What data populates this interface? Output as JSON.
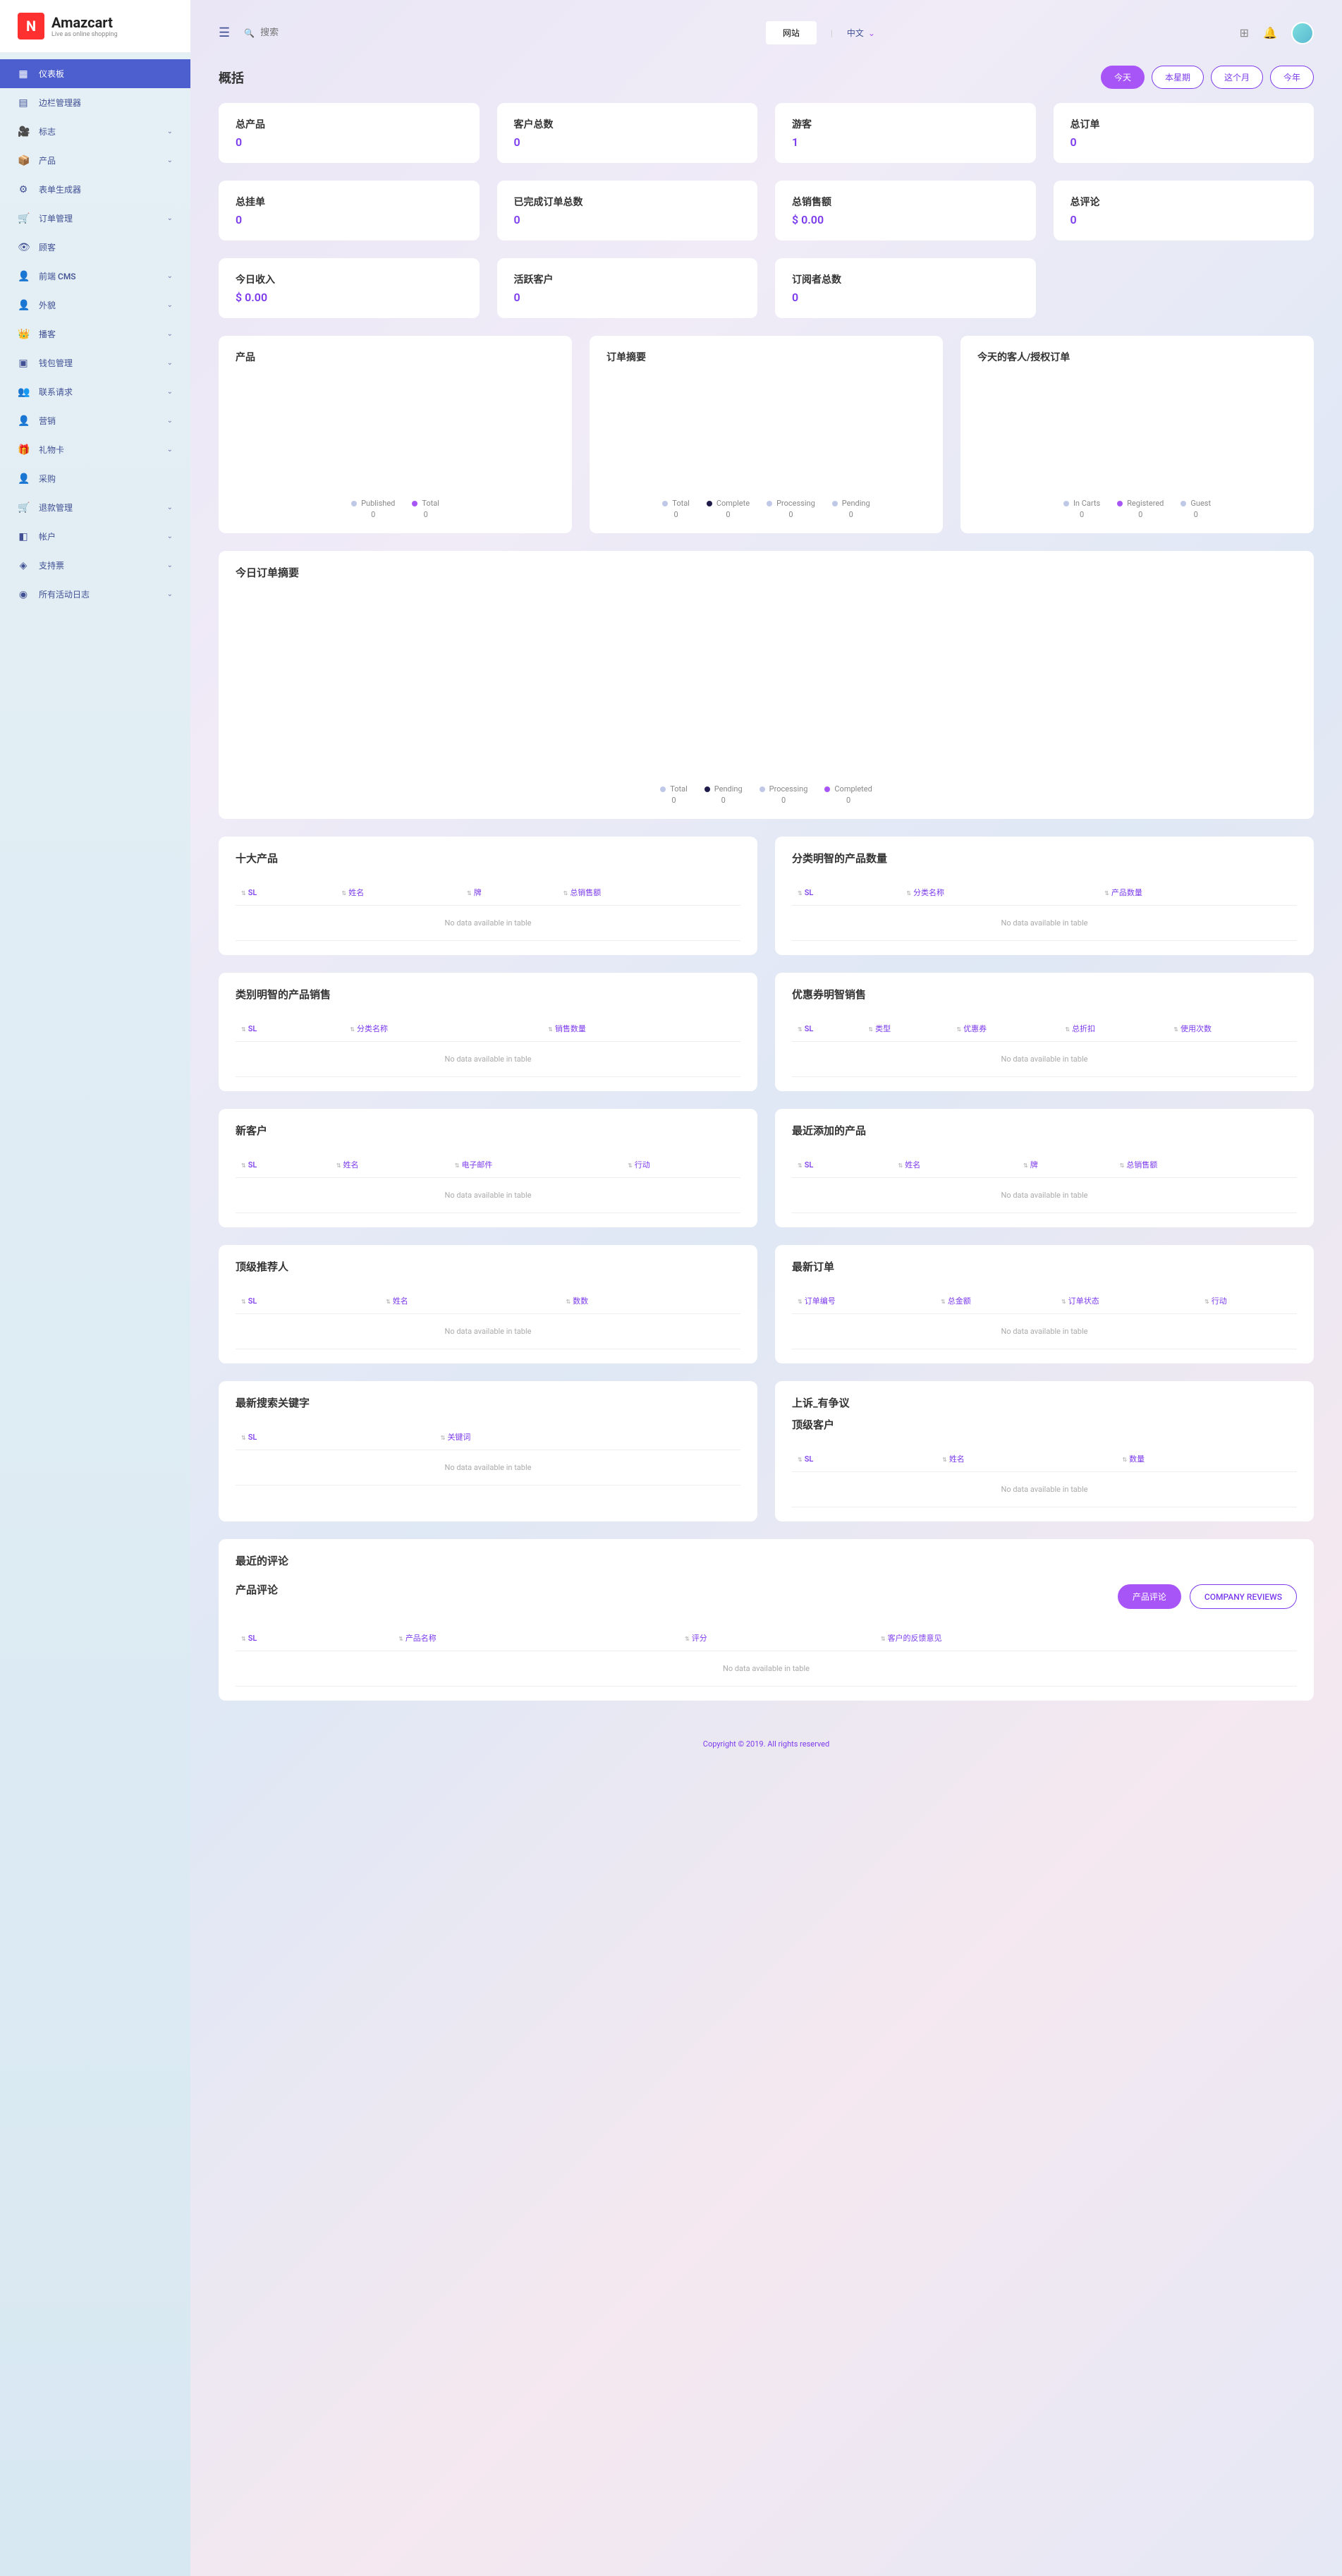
{
  "logo": {
    "name": "Amazcart",
    "tagline": "Live as online shopping"
  },
  "nav": [
    {
      "icon": "▦",
      "label": "仪表板",
      "active": true,
      "sub": false
    },
    {
      "icon": "▤",
      "label": "边栏管理器",
      "active": false,
      "sub": false
    },
    {
      "icon": "🎥",
      "label": "标志",
      "active": false,
      "sub": true
    },
    {
      "icon": "📦",
      "label": "产品",
      "active": false,
      "sub": true
    },
    {
      "icon": "⚙",
      "label": "表单生成器",
      "active": false,
      "sub": false
    },
    {
      "icon": "🛒",
      "label": "订单管理",
      "active": false,
      "sub": true
    },
    {
      "icon": "👁",
      "label": "顾客",
      "active": false,
      "sub": false
    },
    {
      "icon": "👤",
      "label": "前端 CMS",
      "active": false,
      "sub": true
    },
    {
      "icon": "👤",
      "label": "外貌",
      "active": false,
      "sub": true
    },
    {
      "icon": "👑",
      "label": "播客",
      "active": false,
      "sub": true
    },
    {
      "icon": "▣",
      "label": "钱包管理",
      "active": false,
      "sub": true
    },
    {
      "icon": "👥",
      "label": "联系请求",
      "active": false,
      "sub": true
    },
    {
      "icon": "👤",
      "label": "营销",
      "active": false,
      "sub": true
    },
    {
      "icon": "🎁",
      "label": "礼物卡",
      "active": false,
      "sub": true
    },
    {
      "icon": "👤",
      "label": "采购",
      "active": false,
      "sub": false
    },
    {
      "icon": "🛒",
      "label": "退款管理",
      "active": false,
      "sub": true
    },
    {
      "icon": "◧",
      "label": "帐户",
      "active": false,
      "sub": true
    },
    {
      "icon": "◈",
      "label": "支持票",
      "active": false,
      "sub": true
    },
    {
      "icon": "◉",
      "label": "所有活动日志",
      "active": false,
      "sub": true
    }
  ],
  "topbar": {
    "search_ph": "搜索",
    "website": "网站",
    "lang": "中文"
  },
  "overview": {
    "title": "概括"
  },
  "filters": [
    {
      "label": "今天",
      "active": true
    },
    {
      "label": "本星期",
      "active": false
    },
    {
      "label": "这个月",
      "active": false
    },
    {
      "label": "今年",
      "active": false
    }
  ],
  "stats": [
    {
      "label": "总产品",
      "value": "0"
    },
    {
      "label": "客户总数",
      "value": "0"
    },
    {
      "label": "游客",
      "value": "1"
    },
    {
      "label": "总订单",
      "value": "0"
    },
    {
      "label": "总挂单",
      "value": "0"
    },
    {
      "label": "已完成订单总数",
      "value": "0"
    },
    {
      "label": "总销售额",
      "value": "$ 0.00"
    },
    {
      "label": "总评论",
      "value": "0"
    },
    {
      "label": "今日收入",
      "value": "$ 0.00"
    },
    {
      "label": "活跃客户",
      "value": "0"
    },
    {
      "label": "订阅者总数",
      "value": "0"
    }
  ],
  "charts": {
    "c1": {
      "title": "产品",
      "legend": [
        {
          "label": "Published",
          "v": "0",
          "c": "#c0c8e8"
        },
        {
          "label": "Total",
          "v": "0",
          "c": "#a855f7"
        }
      ]
    },
    "c2": {
      "title": "订单摘要",
      "legend": [
        {
          "label": "Total",
          "v": "0",
          "c": "#c0c8e8"
        },
        {
          "label": "Complete",
          "v": "0",
          "c": "#1e1b4b"
        },
        {
          "label": "Processing",
          "v": "0",
          "c": "#c0c8e8"
        },
        {
          "label": "Pending",
          "v": "0",
          "c": "#c0c8e8"
        }
      ]
    },
    "c3": {
      "title": "今天的客人/授权订单",
      "legend": [
        {
          "label": "In Carts",
          "v": "0",
          "c": "#c0c8e8"
        },
        {
          "label": "Registered",
          "v": "0",
          "c": "#a855f7"
        },
        {
          "label": "Guest",
          "v": "0",
          "c": "#c0c8e8"
        }
      ]
    },
    "wide": {
      "title": "今日订单摘要",
      "legend": [
        {
          "label": "Total",
          "v": "0",
          "c": "#c0c8e8"
        },
        {
          "label": "Pending",
          "v": "0",
          "c": "#1e1b4b"
        },
        {
          "label": "Processing",
          "v": "0",
          "c": "#c0c8e8"
        },
        {
          "label": "Completed",
          "v": "0",
          "c": "#a855f7"
        }
      ]
    }
  },
  "tables": {
    "top_products": {
      "title": "十大产品",
      "cols": [
        "SL",
        "姓名",
        "牌",
        "总销售额"
      ]
    },
    "cat_products": {
      "title": "分类明智的产品数量",
      "cols": [
        "SL",
        "分类名称",
        "产品数量"
      ]
    },
    "cat_sales": {
      "title": "类别明智的产品销售",
      "cols": [
        "SL",
        "分类名称",
        "销售数量"
      ]
    },
    "coupon_sales": {
      "title": "优惠券明智销售",
      "cols": [
        "SL",
        "类型",
        "优惠券",
        "总折扣",
        "使用次数"
      ]
    },
    "new_customers": {
      "title": "新客户",
      "cols": [
        "SL",
        "姓名",
        "电子邮件",
        "行动"
      ]
    },
    "recent_products": {
      "title": "最近添加的产品",
      "cols": [
        "SL",
        "姓名",
        "牌",
        "总销售额"
      ]
    },
    "top_referrers": {
      "title": "顶级推荐人",
      "cols": [
        "SL",
        "姓名",
        "数数"
      ]
    },
    "latest_orders": {
      "title": "最新订单",
      "cols": [
        "订单编号",
        "总金额",
        "订单状态",
        "行动"
      ]
    },
    "latest_search": {
      "title": "最新搜索关键字",
      "cols": [
        "SL",
        "关键词"
      ]
    },
    "appeals": {
      "title": "上诉_有争议"
    },
    "top_customers": {
      "title": "顶级客户",
      "cols": [
        "SL",
        "姓名",
        "数量"
      ]
    },
    "recent_reviews": {
      "title": "最近的评论",
      "subtitle": "产品评论",
      "tabs": [
        "产品评论",
        "COMPANY REVIEWS"
      ],
      "cols": [
        "SL",
        "产品名称",
        "评分",
        "客户的反馈意见"
      ]
    }
  },
  "no_data": "No data available in table",
  "footer": {
    "text": "Copyright © 2019. All rights reserved"
  },
  "chart_data": [
    {
      "type": "pie",
      "title": "产品",
      "series": [
        {
          "name": "Published",
          "value": 0
        },
        {
          "name": "Total",
          "value": 0
        }
      ]
    },
    {
      "type": "pie",
      "title": "订单摘要",
      "series": [
        {
          "name": "Total",
          "value": 0
        },
        {
          "name": "Complete",
          "value": 0
        },
        {
          "name": "Processing",
          "value": 0
        },
        {
          "name": "Pending",
          "value": 0
        }
      ]
    },
    {
      "type": "pie",
      "title": "今天的客人/授权订单",
      "series": [
        {
          "name": "In Carts",
          "value": 0
        },
        {
          "name": "Registered",
          "value": 0
        },
        {
          "name": "Guest",
          "value": 0
        }
      ]
    },
    {
      "type": "line",
      "title": "今日订单摘要",
      "series": [
        {
          "name": "Total",
          "values": []
        },
        {
          "name": "Pending",
          "values": []
        },
        {
          "name": "Processing",
          "values": []
        },
        {
          "name": "Completed",
          "values": []
        }
      ]
    }
  ]
}
